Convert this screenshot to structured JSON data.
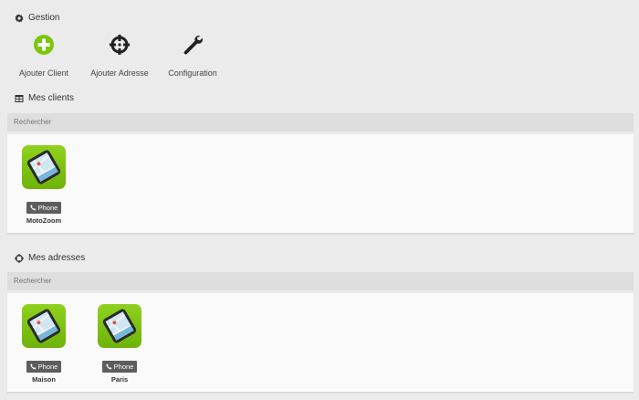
{
  "gestion": {
    "title": "Gestion",
    "icon": "cog-icon",
    "actions": [
      {
        "label": "Ajouter Client",
        "icon": "plus-circle-icon",
        "color": "#7ac70c"
      },
      {
        "label": "Ajouter Adresse",
        "icon": "crosshair-icon",
        "color": "#222222"
      },
      {
        "label": "Configuration",
        "icon": "wrench-icon",
        "color": "#222222"
      }
    ]
  },
  "clients": {
    "title": "Mes clients",
    "icon": "table-icon",
    "search_placeholder": "Rechercher",
    "items": [
      {
        "badge": "Phone",
        "name": "MotoZoom",
        "icon": "phone-map-app-icon"
      }
    ]
  },
  "adresses": {
    "title": "Mes adresses",
    "icon": "crosshair-icon",
    "search_placeholder": "Rechercher",
    "items": [
      {
        "badge": "Phone",
        "name": "Maison",
        "icon": "phone-map-app-icon"
      },
      {
        "badge": "Phone",
        "name": "Paris",
        "icon": "phone-map-app-icon"
      }
    ]
  },
  "colors": {
    "background": "#ebebeb",
    "search_bar": "#dedede",
    "panel": "#fafafa",
    "app_icon_green": "#7ac70c",
    "badge": "#5d5d5d"
  }
}
